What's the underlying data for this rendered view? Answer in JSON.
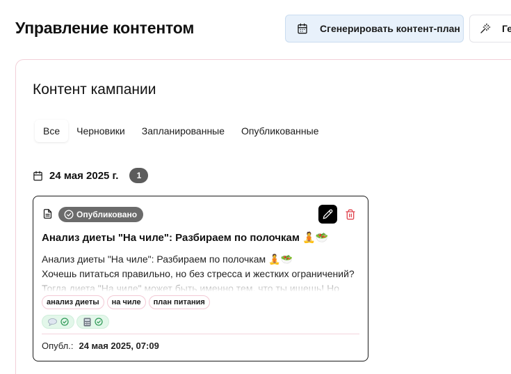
{
  "header": {
    "title": "Управление контентом",
    "generate_plan_label": "Сгенерировать контент-план",
    "generate_label": "Ге"
  },
  "section": {
    "title": "Контент кампании",
    "tabs": [
      {
        "label": "Все",
        "active": true
      },
      {
        "label": "Черновики",
        "active": false
      },
      {
        "label": "Запланированные",
        "active": false
      },
      {
        "label": "Опубликованные",
        "active": false
      }
    ]
  },
  "group": {
    "date": "24 мая 2025 г.",
    "count": "1"
  },
  "post": {
    "status": "Опубликовано",
    "title": "Анализ диеты \"На чиле\": Разбираем по полочкам 🧘🥗",
    "body_lines": [
      "Анализ диеты \"На чиле\": Разбираем по полочкам 🧘🥗",
      "Хочешь питаться правильно, но без стресса и жестких ограничений?",
      "Тогда диета \"На чиле\" может быть именно тем, что ты ищешь! Но"
    ],
    "tags": [
      "анализ диеты",
      "на чиле",
      "план питания"
    ],
    "channels": [
      {
        "icon": "speech-bubble-icon",
        "status": "check-circle-icon"
      },
      {
        "icon": "calculator-icon",
        "status": "check-circle-icon"
      }
    ],
    "published_label": "Опубл.:",
    "published_value": "24 мая 2025, 07:09"
  },
  "colors": {
    "accent_button_bg": "#e8f1fb",
    "panel_border": "#f2cfd8",
    "status_badge": "#6b6b6b",
    "delete_red": "#e0454f",
    "channel_green": "#e3f7ea"
  }
}
